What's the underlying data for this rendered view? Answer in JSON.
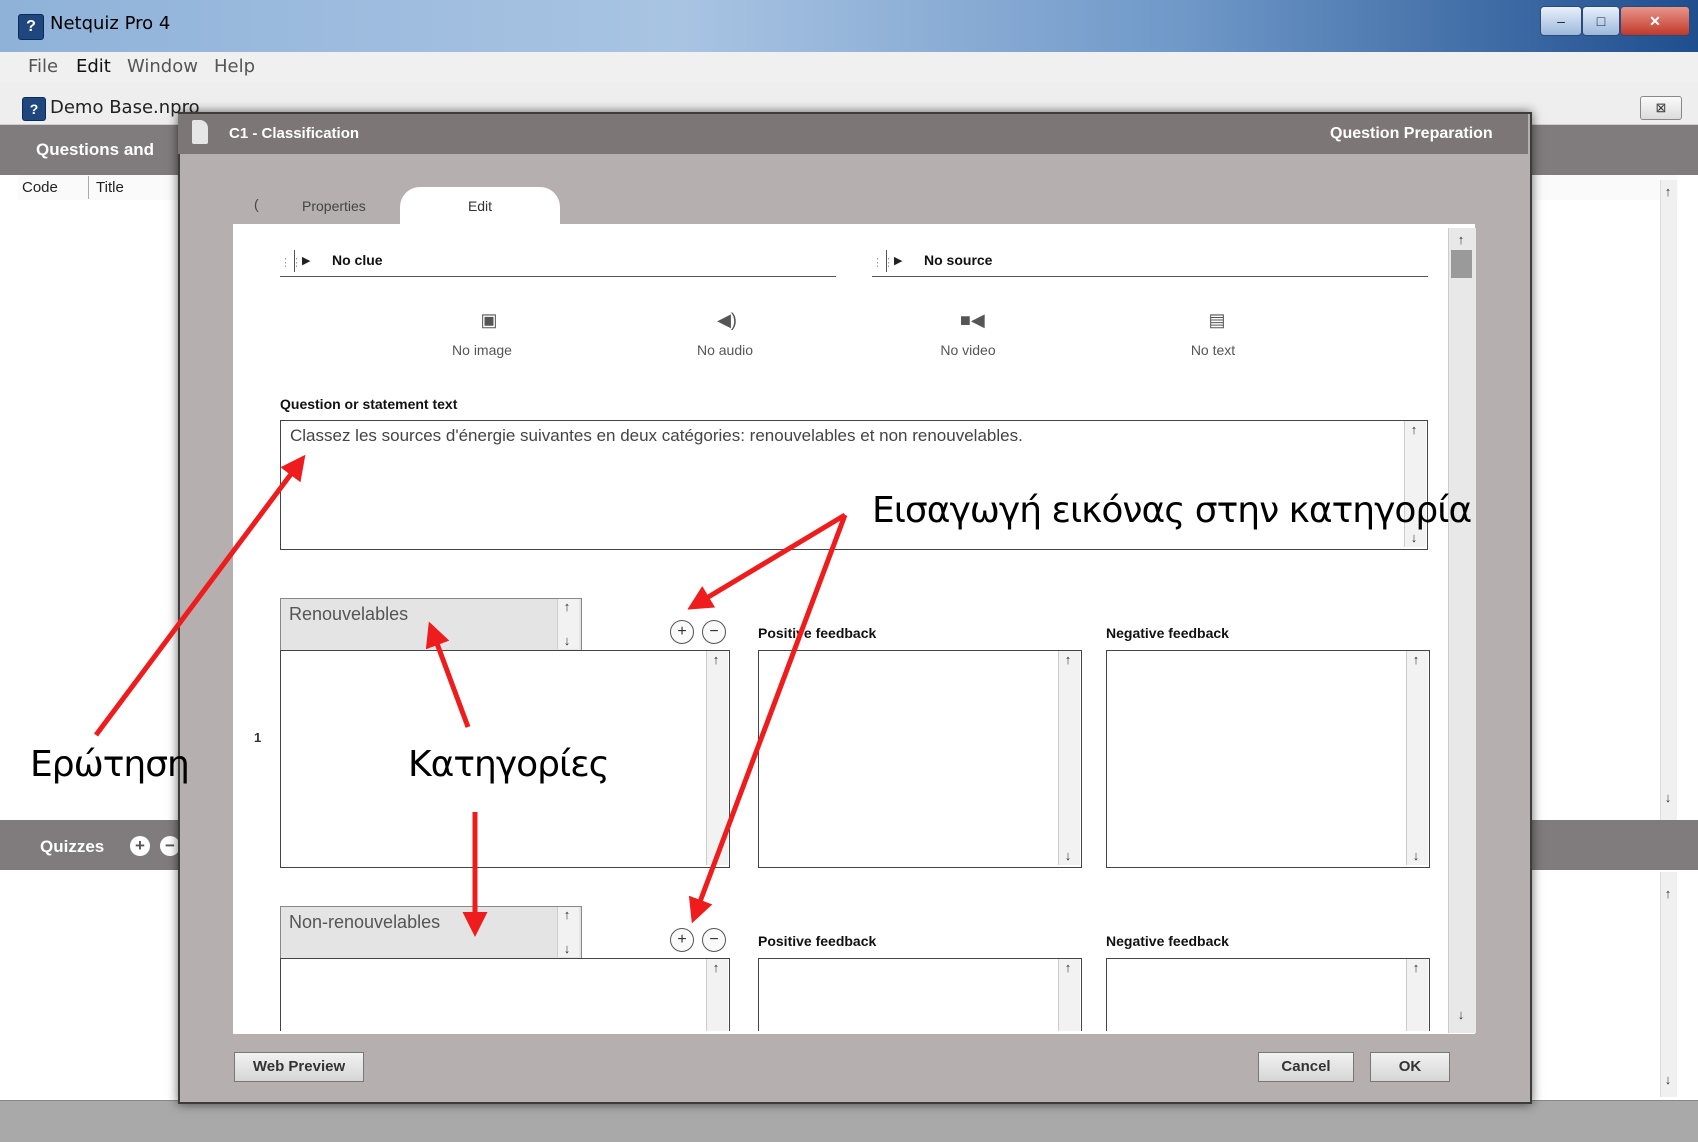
{
  "window": {
    "title": "Netquiz Pro 4",
    "icon": "question-icon",
    "controls": [
      "–",
      "□",
      "✕"
    ]
  },
  "menu": [
    "File",
    "Edit",
    "Window",
    "Help"
  ],
  "document": {
    "name": "Demo Base.npro",
    "close_symbol": "⊠"
  },
  "questions_panel": {
    "header": "Questions and",
    "columns": [
      "Code",
      "Title"
    ]
  },
  "quizzes_panel": {
    "header": "Quizzes",
    "add": "+",
    "remove": "−"
  },
  "dialog": {
    "title": "C1 - Classification",
    "section": "Question Preparation",
    "tabs": {
      "chevron": "(",
      "properties": "Properties",
      "edit": "Edit"
    },
    "clue": "No clue",
    "source": "No source",
    "media": [
      {
        "label": "No image",
        "icon": "image-icon"
      },
      {
        "label": "No audio",
        "icon": "audio-icon"
      },
      {
        "label": "No video",
        "icon": "video-icon"
      },
      {
        "label": "No text",
        "icon": "text-document-icon"
      }
    ],
    "question_label": "Question or statement text",
    "question_text": "Classez les sources d'énergie suivantes en deux catégories: renouvelables et non renouvelables.",
    "categories": [
      {
        "number": "1",
        "name": "Renouvelables",
        "positive_label": "Positive feedback",
        "negative_label": "Negative feedback"
      },
      {
        "number": "",
        "name": "Non-renouvelables",
        "positive_label": "Positive feedback",
        "negative_label": "Negative feedback"
      }
    ],
    "buttons": {
      "web_preview": "Web Preview",
      "cancel": "Cancel",
      "ok": "OK"
    }
  },
  "annotations": {
    "question": "Ερώτηση",
    "categories": "Κατηγορίες",
    "insert_image": "Εισαγωγή εικόνας στην κατηγορία"
  },
  "colors": {
    "annotation_arrow": "#ee1c1c",
    "panel_header": "#807b7c",
    "dialog_bg": "#b5afaf"
  }
}
